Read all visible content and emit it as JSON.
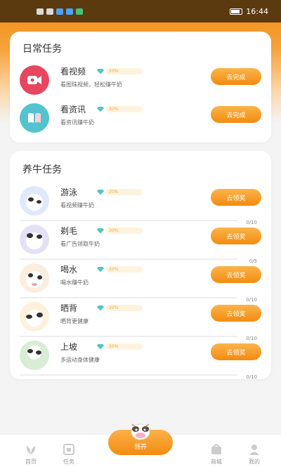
{
  "status_bar": {
    "time": "16:44"
  },
  "daily": {
    "title": "日常任务",
    "tasks": [
      {
        "name": "看视频",
        "desc": "看图珠视频，轻松赚牛奶",
        "badge": "20%",
        "button": "去完成"
      },
      {
        "name": "看资讯",
        "desc": "看资讯赚牛奶",
        "badge": "20%",
        "button": "去完成"
      }
    ]
  },
  "raise": {
    "title": "养牛任务",
    "tasks": [
      {
        "name": "游泳",
        "desc": "看视频赚牛奶",
        "badge": "20%",
        "button": "去领奖",
        "progress": "0/10"
      },
      {
        "name": "剃毛",
        "desc": "看广告领取牛奶",
        "badge": "20%",
        "button": "去领奖",
        "progress": "0/5"
      },
      {
        "name": "喝水",
        "desc": "喝水赚牛奶",
        "badge": "20%",
        "button": "去领奖",
        "progress": "0/10"
      },
      {
        "name": "晒背",
        "desc": "晒背更健康",
        "badge": "20%",
        "button": "去领奖",
        "progress": "0/10"
      },
      {
        "name": "上坡",
        "desc": "多运动身体健康",
        "badge": "20%",
        "button": "去领奖",
        "progress": "0/10"
      }
    ]
  },
  "tabbar": {
    "items": [
      {
        "label": "首页"
      },
      {
        "label": "任务"
      },
      {
        "label": "商城"
      },
      {
        "label": "我的"
      }
    ],
    "center_label": "领养"
  },
  "colors": {
    "accent": "#f38b10",
    "video_icon": "#e8455f",
    "news_icon": "#53c4cf"
  }
}
